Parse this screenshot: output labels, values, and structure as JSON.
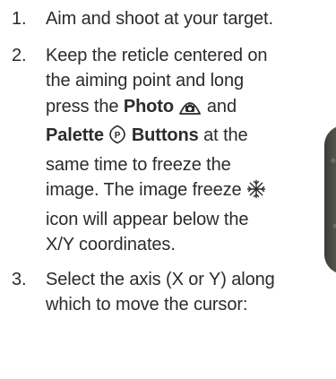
{
  "steps": [
    {
      "number": "1.",
      "text": "Aim and shoot at your target."
    },
    {
      "number": "2.",
      "text_a": "Keep the reticle centered on the aiming point and long press the ",
      "photo_label": "Photo",
      "text_b": " and ",
      "palette_label": "Palette",
      "buttons_label": "Buttons",
      "text_c": " at the same time to freeze the image. The image freeze ",
      "text_d": " icon will appear below the X/Y coordinates."
    },
    {
      "number": "3.",
      "text": "Select the axis (X or Y) along which to move the cursor:"
    }
  ],
  "icons": {
    "photo": "camera-button-icon",
    "palette": "palette-p-icon",
    "freeze": "snowflake-freeze-icon"
  },
  "colors": {
    "text": "#2b2b2b"
  }
}
